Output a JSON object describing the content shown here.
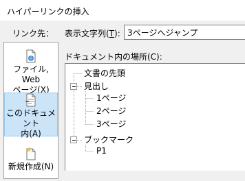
{
  "dialog": {
    "title": "ハイパーリンクの挿入"
  },
  "link_to": {
    "label": "リンク先："
  },
  "display_text": {
    "label_prefix": "表示文字列(",
    "label_key": "T",
    "label_suffix": "):",
    "value": "3ページへジャンプ"
  },
  "link_buttons": [
    {
      "label": "ファイル, Web\nページ(X)",
      "icon": "web-page-icon",
      "selected": false
    },
    {
      "label": "このドキュメント\n内(A)",
      "icon": "document-place-icon",
      "selected": true
    },
    {
      "label": "新規作成(N)",
      "icon": "new-document-icon",
      "selected": false
    }
  ],
  "place": {
    "label": "ドキュメント内の場所(C):"
  },
  "tree": {
    "top_of_document": "文書の先頭",
    "headings": {
      "label": "見出し",
      "items": [
        "1ページ",
        "2ページ",
        "3ページ"
      ]
    },
    "bookmarks": {
      "label": "ブックマーク",
      "items": [
        "P1"
      ]
    }
  },
  "colors": {
    "selected_bg": "#cce4f7",
    "selected_border": "#99c9ef",
    "dialog_bg": "#f0f0f0"
  }
}
